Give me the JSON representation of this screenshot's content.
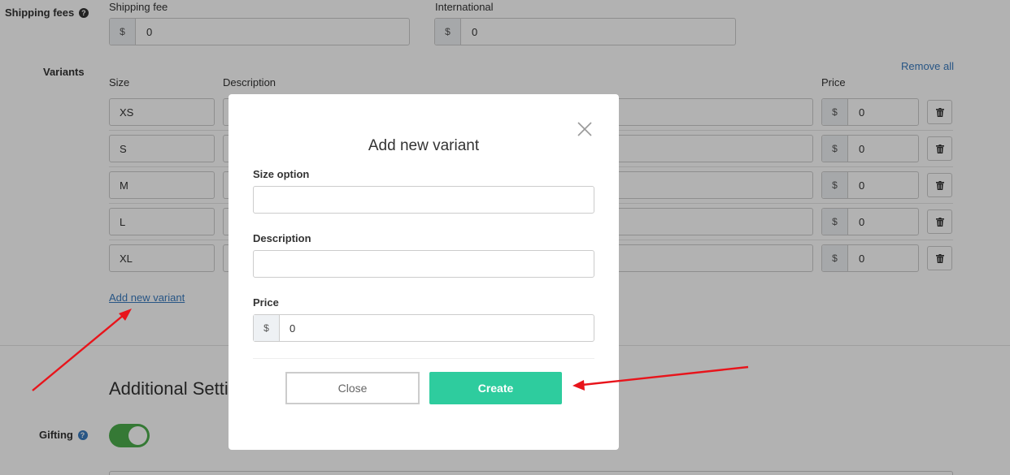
{
  "shipping": {
    "label": "Shipping fees",
    "fee_label": "Shipping fee",
    "fee_currency": "$",
    "fee_value": "0",
    "intl_label": "International",
    "intl_currency": "$",
    "intl_value": "0"
  },
  "variants": {
    "label": "Variants",
    "remove_all": "Remove all",
    "col_size": "Size",
    "col_description": "Description",
    "col_price": "Price",
    "rows": [
      {
        "size": "XS",
        "currency": "$",
        "price": "0"
      },
      {
        "size": "S",
        "currency": "$",
        "price": "0"
      },
      {
        "size": "M",
        "currency": "$",
        "price": "0"
      },
      {
        "size": "L",
        "currency": "$",
        "price": "0"
      },
      {
        "size": "XL",
        "currency": "$",
        "price": "0"
      }
    ],
    "add_new": "Add new variant"
  },
  "additional": {
    "title": "Additional Settings",
    "gifting_label": "Gifting",
    "gifting_on": true
  },
  "modal": {
    "title": "Add new variant",
    "size_label": "Size option",
    "size_value": "",
    "description_label": "Description",
    "description_value": "",
    "price_label": "Price",
    "price_currency": "$",
    "price_value": "0",
    "close_button": "Close",
    "create_button": "Create"
  },
  "colors": {
    "accent": "#2ecc9e",
    "link": "#3a7bbf",
    "toggle_on": "#4cae4c",
    "annotation_arrow": "#e8141b"
  },
  "icons": [
    "question-circle-icon",
    "trash-icon",
    "close-icon"
  ]
}
